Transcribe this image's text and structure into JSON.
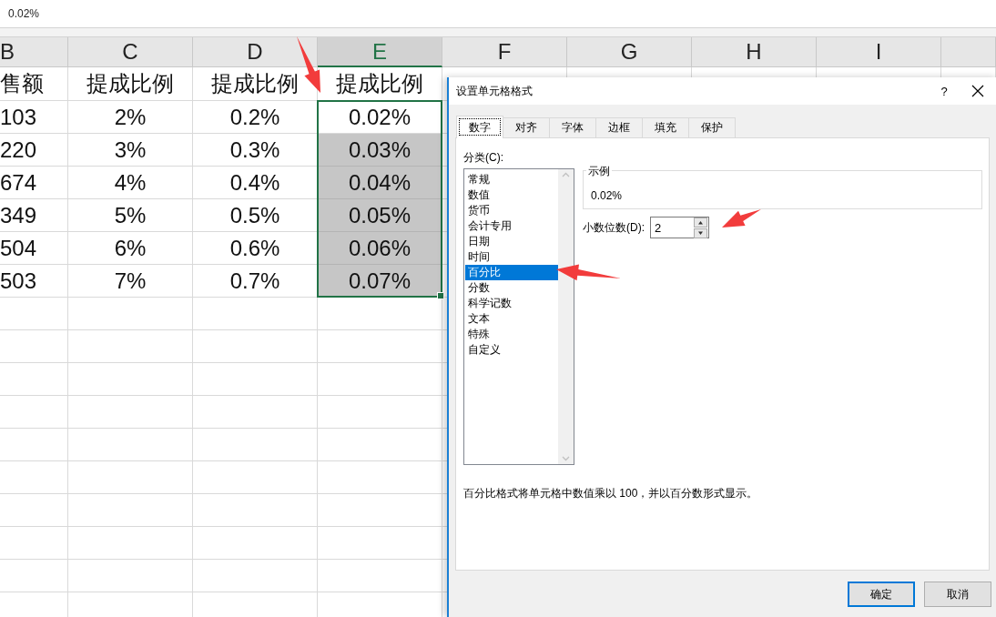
{
  "formula_bar": {
    "value": "0.02%"
  },
  "columns": [
    {
      "label": "B",
      "selected": false
    },
    {
      "label": "C",
      "selected": false
    },
    {
      "label": "D",
      "selected": false
    },
    {
      "label": "E",
      "selected": true
    },
    {
      "label": "F",
      "selected": false
    },
    {
      "label": "G",
      "selected": false
    },
    {
      "label": "H",
      "selected": false
    },
    {
      "label": "I",
      "selected": false
    }
  ],
  "rows": [
    {
      "cells": [
        {
          "text": "售额"
        },
        {
          "text": "提成比例"
        },
        {
          "text": "提成比例"
        },
        {
          "text": "提成比例"
        }
      ]
    },
    {
      "cells": [
        {
          "text": "103"
        },
        {
          "text": "2%"
        },
        {
          "text": "0.2%"
        },
        {
          "text": "0.02%",
          "selected": false,
          "active": true
        }
      ]
    },
    {
      "cells": [
        {
          "text": "220"
        },
        {
          "text": "3%"
        },
        {
          "text": "0.3%"
        },
        {
          "text": "0.03%",
          "selected": true
        }
      ]
    },
    {
      "cells": [
        {
          "text": "674"
        },
        {
          "text": "4%"
        },
        {
          "text": "0.4%"
        },
        {
          "text": "0.04%",
          "selected": true
        }
      ]
    },
    {
      "cells": [
        {
          "text": "349"
        },
        {
          "text": "5%"
        },
        {
          "text": "0.5%"
        },
        {
          "text": "0.05%",
          "selected": true
        }
      ]
    },
    {
      "cells": [
        {
          "text": "504"
        },
        {
          "text": "6%"
        },
        {
          "text": "0.6%"
        },
        {
          "text": "0.06%",
          "selected": true
        }
      ]
    },
    {
      "cells": [
        {
          "text": "503"
        },
        {
          "text": "7%"
        },
        {
          "text": "0.7%"
        },
        {
          "text": "0.07%",
          "selected": true
        }
      ]
    }
  ],
  "dialog": {
    "title": "设置单元格格式",
    "help": "?",
    "tabs": [
      {
        "label": "数字",
        "selected": true
      },
      {
        "label": "对齐",
        "selected": false
      },
      {
        "label": "字体",
        "selected": false
      },
      {
        "label": "边框",
        "selected": false
      },
      {
        "label": "填充",
        "selected": false
      },
      {
        "label": "保护",
        "selected": false
      }
    ],
    "category_label": "分类(C):",
    "categories": [
      {
        "label": "常规",
        "selected": false
      },
      {
        "label": "数值",
        "selected": false
      },
      {
        "label": "货币",
        "selected": false
      },
      {
        "label": "会计专用",
        "selected": false
      },
      {
        "label": "日期",
        "selected": false
      },
      {
        "label": "时间",
        "selected": false
      },
      {
        "label": "百分比",
        "selected": true
      },
      {
        "label": "分数",
        "selected": false
      },
      {
        "label": "科学记数",
        "selected": false
      },
      {
        "label": "文本",
        "selected": false
      },
      {
        "label": "特殊",
        "selected": false
      },
      {
        "label": "自定义",
        "selected": false
      }
    ],
    "sample": {
      "legend": "示例",
      "value": "0.02%"
    },
    "decimal_places": {
      "label": "小数位数(D):",
      "value": "2"
    },
    "description": "百分比格式将单元格中数值乘以 100，并以百分数形式显示。",
    "buttons": [
      {
        "label": "确定",
        "default": true
      },
      {
        "label": "取消",
        "default": false
      }
    ]
  }
}
